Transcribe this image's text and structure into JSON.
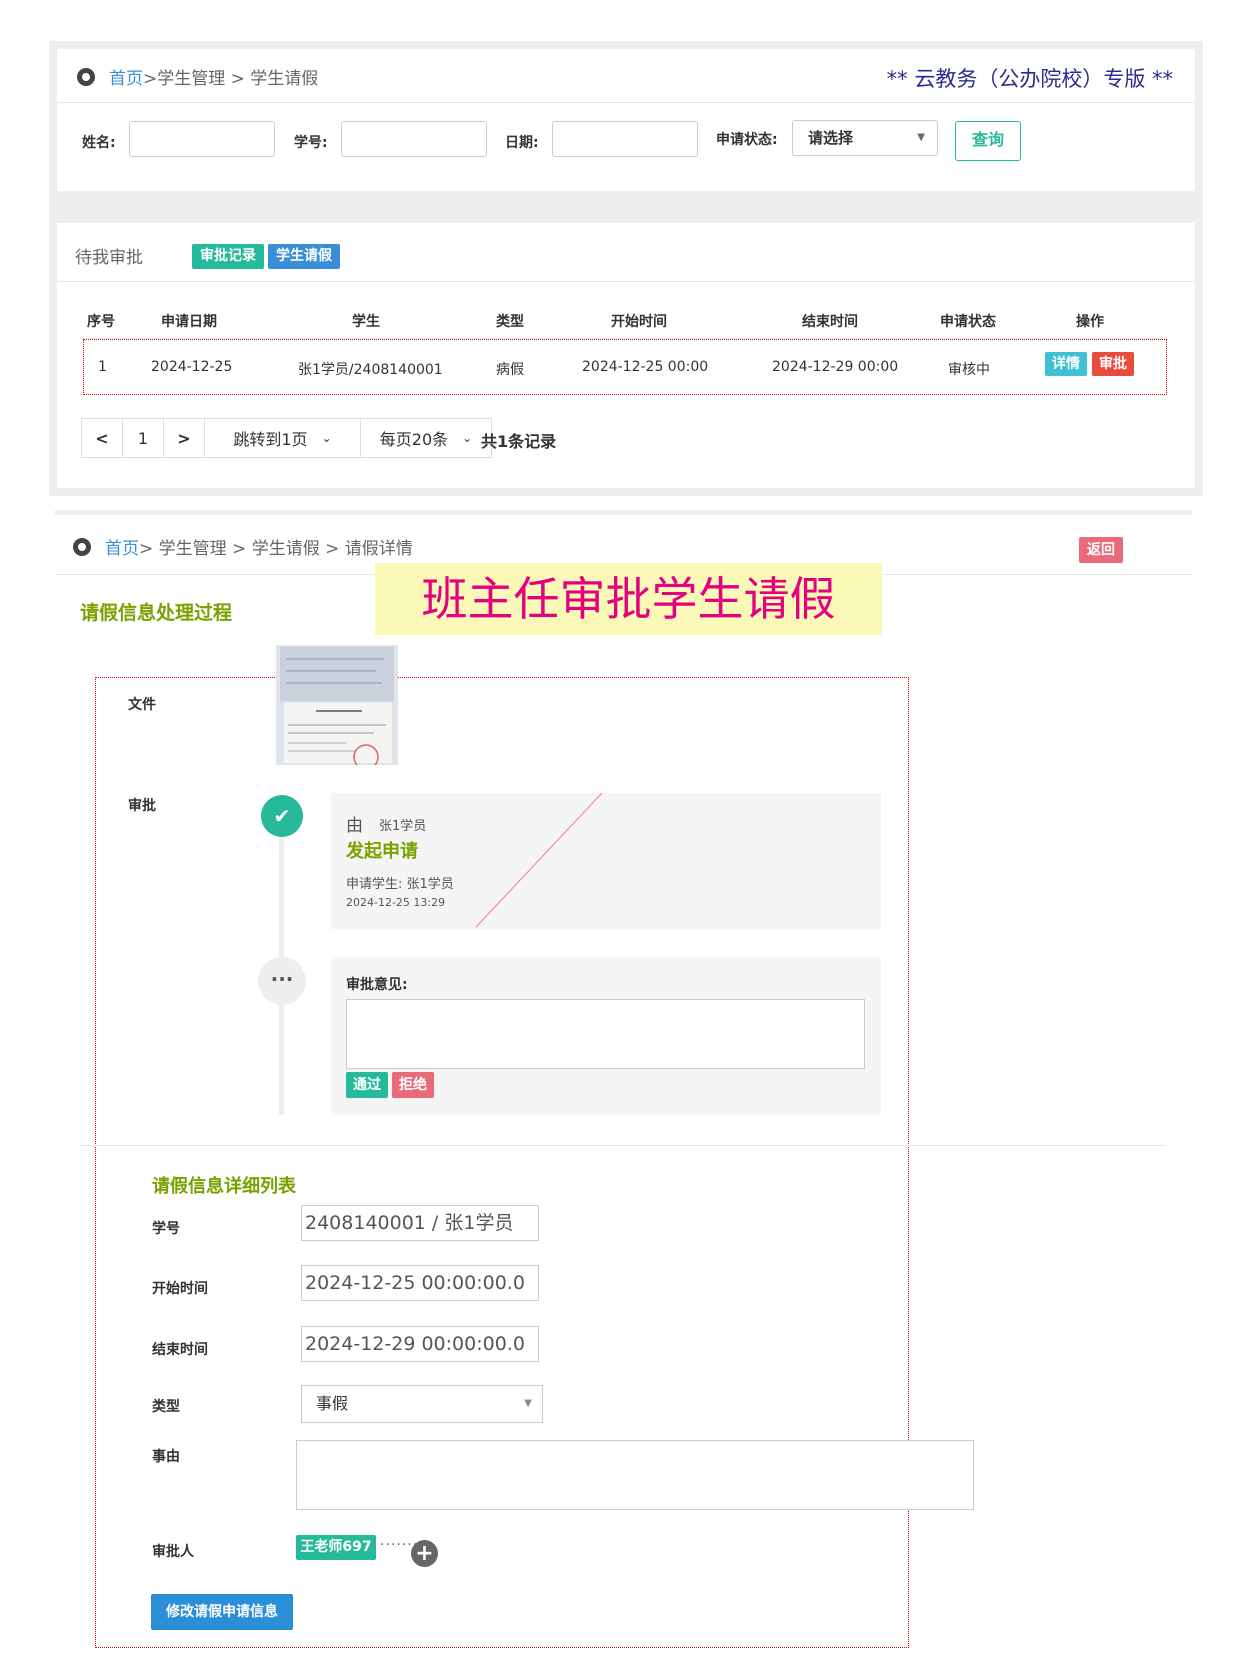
{
  "top": {
    "breadcrumb": {
      "home": "首页",
      "rest": " >学生管理 > 学生请假"
    },
    "brand": "** 云教务（公办院校）专版 **",
    "filters": {
      "name_label": "姓名:",
      "id_label": "学号:",
      "date_label": "日期:",
      "status_label": "申请状态:",
      "status_value": "请选择",
      "query_label": "查询"
    }
  },
  "pending": {
    "title": "待我审批",
    "tags": {
      "records": "审批记录",
      "leave": "学生请假"
    },
    "columns": [
      "序号",
      "申请日期",
      "学生",
      "类型",
      "开始时间",
      "结束时间",
      "申请状态",
      "操作"
    ],
    "rows": [
      {
        "index": "1",
        "date": "2024-12-25",
        "student": "张1学员/2408140001",
        "type": "病假",
        "start": "2024-12-25 00:00",
        "end": "2024-12-29 00:00",
        "status": "审核中",
        "detail": "详情",
        "approve": "审批"
      }
    ],
    "pager": {
      "page": "1",
      "jump": "跳转到1页",
      "per_page": "每页20条",
      "total": "共1条记录"
    }
  },
  "detail": {
    "breadcrumb": {
      "home": "首页",
      "rest": " > 学生管理 > 学生请假 > 请假详情"
    },
    "back": "返回",
    "banner": "班主任审批学生请假",
    "process_title": "请假信息处理过程",
    "file_label": "文件",
    "approve_label": "审批",
    "timeline": {
      "by_prefix": "由",
      "by_name": "张1学员",
      "action": "发起申请",
      "applicant": "申请学生:  张1学员",
      "time": "2024-12-25 13:29",
      "opinion_label": "审批意见:",
      "pass": "通过",
      "reject": "拒绝"
    },
    "info_title": "请假信息详细列表",
    "form": {
      "id_label": "学号",
      "id_value": "2408140001 / 张1学员",
      "start_label": "开始时间",
      "start_value": "2024-12-25 00:00:00.0",
      "end_label": "结束时间",
      "end_value": "2024-12-29 00:00:00.0",
      "type_label": "类型",
      "type_value": "事假",
      "reason_label": "事由",
      "approver_label": "审批人",
      "approver_value": "王老师697",
      "submit": "修改请假申请信息"
    }
  },
  "colors": {
    "teal": "#26b99a",
    "blue": "#3a8ed6",
    "red": "#e74c3c",
    "olive": "#7aa100",
    "banner_bg": "#fbf9b8",
    "banner_text": "#e4007f"
  }
}
